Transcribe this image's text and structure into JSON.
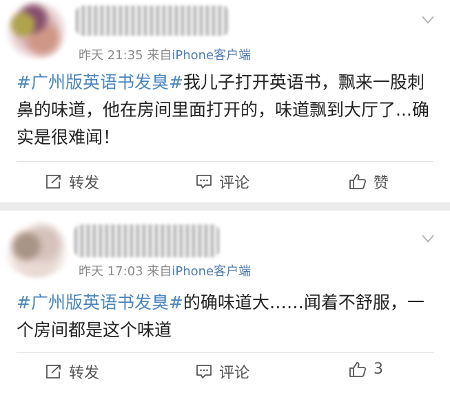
{
  "posts": [
    {
      "time": "昨天 21:35",
      "source_prefix": "来自",
      "source": "iPhone客户端",
      "topic": "#广州版英语书发臭#",
      "text": "我儿子打开英语书，飘来一股刺鼻的味道，他在房间里面打开的，味道飘到大厅了...确实是很难闻！",
      "actions": {
        "repost": "转发",
        "comment": "评论",
        "like": "赞"
      }
    },
    {
      "time": "昨天 17:03",
      "source_prefix": "来自",
      "source": "iPhone客户端",
      "topic": "#广州版英语书发臭#",
      "text": "的确味道大……闻着不舒服，一个房间都是这个味道",
      "actions": {
        "repost": "转发",
        "comment": "评论",
        "like": "3"
      }
    }
  ],
  "colors": {
    "topic": "#4a86c0",
    "source": "#507daf",
    "meta": "#8a8a8a",
    "background": "#ebebeb"
  },
  "icons": {
    "chevron": "chevron-down-icon",
    "repost": "repost-icon",
    "comment": "comment-icon",
    "like": "thumbs-up-icon"
  }
}
